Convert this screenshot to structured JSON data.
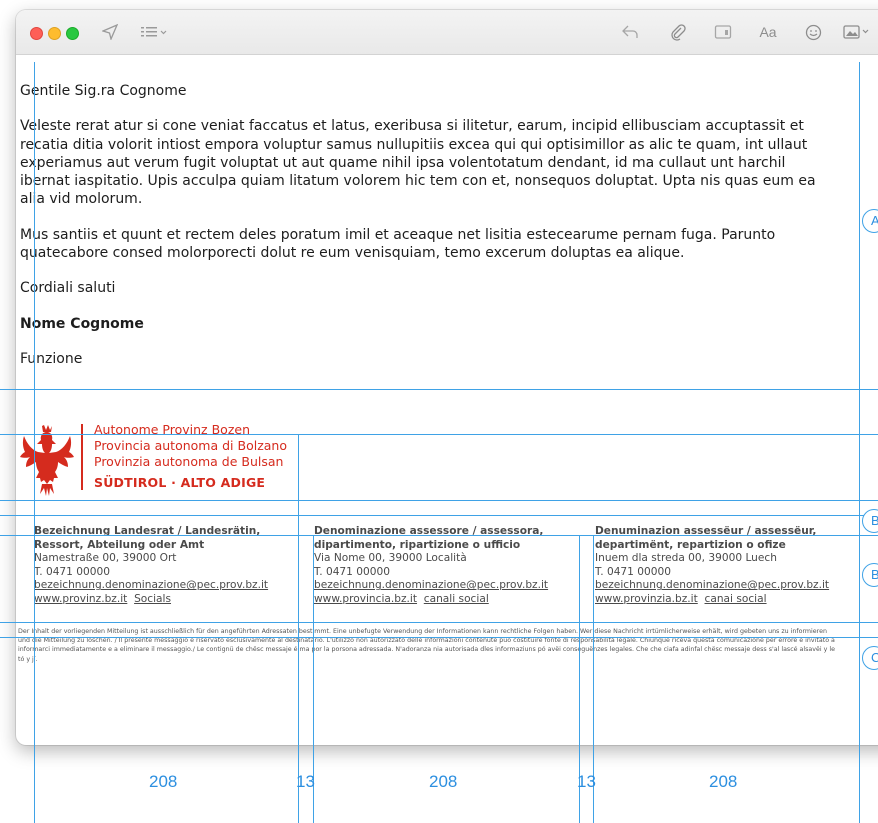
{
  "email": {
    "greeting": "Gentile Sig.ra Cognome",
    "paragraph1": "Veleste rerat atur si cone veniat faccatus et latus, exeribusa si ilitetur, earum, incipid ellibusciam accuptassit et recatia ditia volorit intiost empora voluptur samus nullupitiis excea qui qui optisimillor as alic te quam, int ullaut experiamus aut verum fugit voluptat ut aut quame nihil ipsa volentotatum dendant, id ma cullaut unt harchil ibernat iaspitatio. Upis acculpa quiam litatum volorem hic tem con et, nonsequos doluptat. Upta nis quas eum ea alia vid molorum.",
    "paragraph2": "Mus santiis et quunt et rectem deles poratum imil et aceaque net lisitia estecearume pernam fuga. Parunto quatecabore consed molorporecti dolut re eum venisquiam, temo excerum doluptas ea alique.",
    "closing": "Cordiali saluti",
    "signature_name": "Nome Cognome",
    "signature_function": "Funzione"
  },
  "logo": {
    "line1": "Autonome Provinz Bozen",
    "line2": "Provincia autonoma di Bolzano",
    "line3": "Provinzia autonoma de Bulsan",
    "line4": "SÜDTIROL · ALTO ADIGE",
    "color": "#d52b1e"
  },
  "columns": [
    {
      "title1": "Bezeichnung Landesrat / Landesrätin,",
      "title2": "Ressort, Abteilung oder Amt",
      "address": "Namestraße 00, 39000 Ort",
      "phone": "T. 0471 00000",
      "email": "bezeichnung.denominazione@pec.prov.bz.it",
      "web": "www.provinz.bz.it",
      "social": "Socials"
    },
    {
      "title1": "Denominazione assessore / assessora,",
      "title2": "dipartimento, ripartizione o ufficio",
      "address": "Via Nome 00, 39000 Località",
      "phone": "T. 0471 00000",
      "email": "bezeichnung.denominazione@pec.prov.bz.it",
      "web": "www.provincia.bz.it",
      "social": "canali social"
    },
    {
      "title1": "Denuminazion assessëur / assessëur,",
      "title2": "departimënt, repartizion o ofize",
      "address": "Inuem dla streda 00, 39000 Luech",
      "phone": "T. 0471 00000",
      "email": "bezeichnung.denominazione@pec.prov.bz.it",
      "web": "www.provinzia.bz.it",
      "social": "canai social"
    }
  ],
  "disclaimer": "Der Inhalt der vorliegenden Mitteilung ist ausschließlich für den angeführten Adressaten bestimmt. Eine unbefugte Verwendung der Informationen kann rechtliche Folgen haben. Wer diese Nachricht irrtümlicherweise erhält, wird gebeten uns zu informieren und die Mitteilung zu löschen. / Il presente messaggio è riservato esclusivamente al destinatario. L'utilizzo non autorizzato delle informazioni contenute può costituire fonte di responsabilità legale. Chiunque riceva questa comunicazione per errore è invitato a informarci immediatamente e a eliminare il messaggio./ Le contignü de chësc messaje é ma por la porsona adressada. N'adoranza nia autorisada dles informaziuns pó avëi conseguënzes legales. Che che ciafa adinfal chësc messaje dess s'al lascé alsavëi y le tó y jí.",
  "toolbar": {
    "font_label": "Aa"
  },
  "measurements": {
    "col1": "208",
    "gap1": "13",
    "col2": "208",
    "gap2": "13",
    "col3": "208"
  },
  "markers": {
    "a": "A",
    "b": "B",
    "c": "B",
    "d": "C"
  },
  "colors": {
    "guide": "#3fa2e6",
    "accent": "#d52b1e"
  }
}
